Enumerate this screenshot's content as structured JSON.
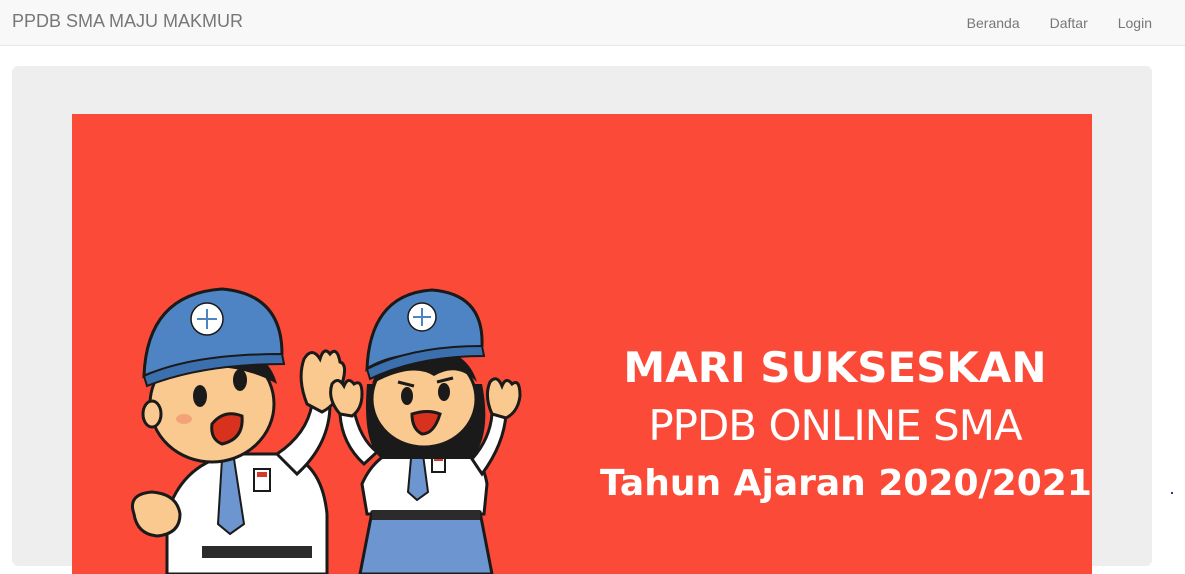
{
  "navbar": {
    "brand": "PPDB SMA MAJU MAKMUR",
    "links": [
      {
        "label": "Beranda"
      },
      {
        "label": "Daftar"
      },
      {
        "label": "Login"
      }
    ]
  },
  "banner": {
    "line1": "MARI SUKSESKAN",
    "line2": "PPDB ONLINE SMA",
    "line3": "Tahun Ajaran 2020/2021",
    "background_color": "#fb4b38"
  },
  "colors": {
    "navbar_bg": "#f8f8f8",
    "jumbotron_bg": "#eeeeee",
    "nav_text": "#777777"
  }
}
